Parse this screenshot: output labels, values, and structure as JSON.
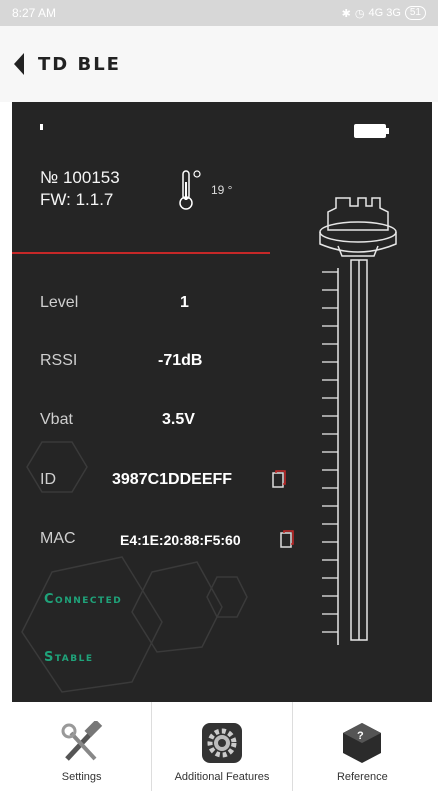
{
  "status_bar": {
    "time": "8:27 AM",
    "network": "4G 3G",
    "battery": "51"
  },
  "app_bar": {
    "title": "TD BLE"
  },
  "device": {
    "number": "№ 100153",
    "firmware": "FW: 1.1.7",
    "temperature": "19 °"
  },
  "readings": [
    {
      "label": "Level",
      "value": "1"
    },
    {
      "label": "RSSI",
      "value": "-71dB"
    },
    {
      "label": "Vbat",
      "value": "3.5V"
    },
    {
      "label": "ID",
      "value": "3987C1DDEEFF"
    },
    {
      "label": "MAC",
      "value": "E4:1E:20:88:F5:60"
    }
  ],
  "status": {
    "connection": "Connected",
    "stability": "Stable"
  },
  "tabs": [
    {
      "label": "Settings",
      "icon": "tools-icon"
    },
    {
      "label": "Additional Features",
      "icon": "gear-icon"
    },
    {
      "label": "Reference",
      "icon": "question-box-icon"
    }
  ],
  "colors": {
    "panel": "#252525",
    "accent_red": "#c62828",
    "status_green": "#1fa37a"
  }
}
